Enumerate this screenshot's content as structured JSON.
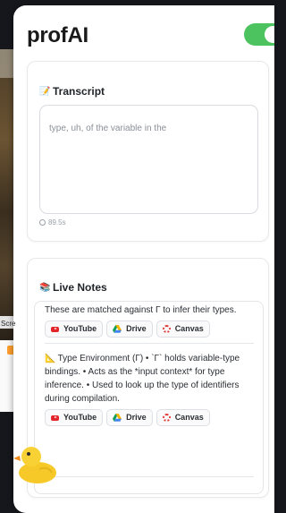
{
  "background": {
    "side_label": "Scre"
  },
  "header": {
    "logo": "profAI",
    "toggle_on": true,
    "accent_color": "#4cc35e"
  },
  "transcript": {
    "icon": "memo-icon",
    "title": "Transcript",
    "text": "type, uh, of the variable in the",
    "duration": "89.5s"
  },
  "live_notes": {
    "icon": "books-icon",
    "title": "Live Notes",
    "notes": [
      {
        "text": "These are matched against Γ to infer their types.",
        "links": [
          "YouTube",
          "Drive",
          "Canvas"
        ]
      },
      {
        "icon": "triangle-ruler-icon",
        "text": "Type Environment (Γ) • `Γ` holds variable-type bindings. • Acts as the *input context* for type inference. • Used to look up the type of identifiers during compilation.",
        "links": [
          "YouTube",
          "Drive",
          "Canvas"
        ]
      }
    ]
  }
}
